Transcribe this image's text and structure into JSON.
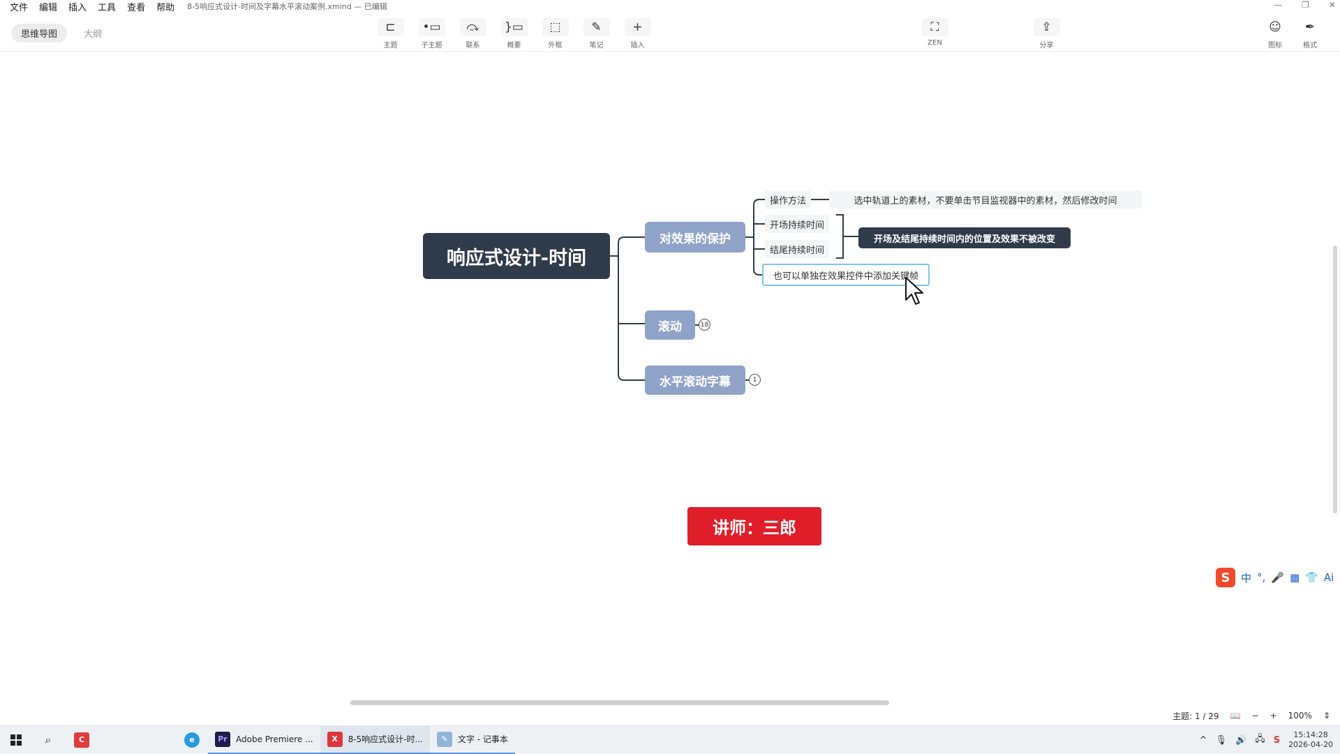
{
  "menu": [
    "文件",
    "编辑",
    "插入",
    "工具",
    "查看",
    "帮助"
  ],
  "doc_title": "8-5响应式设计-时间及字幕水平滚动案例.xmind — 已编辑",
  "view_tabs": [
    "思维导图",
    "大纲"
  ],
  "tools": {
    "topic": "主题",
    "subtopic": "子主题",
    "relation": "联系",
    "summary": "概要",
    "boundary": "外框",
    "note": "笔记",
    "insert": "插入",
    "zen": "ZEN",
    "share": "分享",
    "icon": "图标",
    "format": "格式"
  },
  "mindmap": {
    "central": "响应式设计-时间",
    "branch1": "对效果的保护",
    "branch1_children": [
      "操作方法",
      "开场持续时间",
      "结尾持续时间",
      "也可以单独在效果控件中添加关键帧"
    ],
    "method_detail": "选中轨道上的素材，不要单击节目监视器中的素材，然后修改时间",
    "summary": "开场及结尾持续时间内的位置及效果不被改变",
    "branch2": "滚动",
    "branch2_count": "18",
    "branch3": "水平滚动字幕",
    "branch3_count": "1"
  },
  "teacher_label": "讲师：三郎",
  "ime": {
    "logo": "S",
    "mode": "中",
    "ai": "Ai"
  },
  "status": {
    "topics": "主题: 1 / 29",
    "zoom": "100%"
  },
  "taskbar": {
    "apps": [
      {
        "label": "Adobe Premiere ...",
        "icon": "Pr"
      },
      {
        "label": "8-5响应式设计-时...",
        "icon": "X"
      },
      {
        "label": "文字 - 记事本",
        "icon": "✎"
      }
    ],
    "time": "15:14:28",
    "date": "2026-04-20"
  },
  "colors": {
    "central": "#2f3b4a",
    "branch": "#8fa3c8",
    "teacher": "#e01e2a",
    "selection": "#7ec8e3"
  }
}
